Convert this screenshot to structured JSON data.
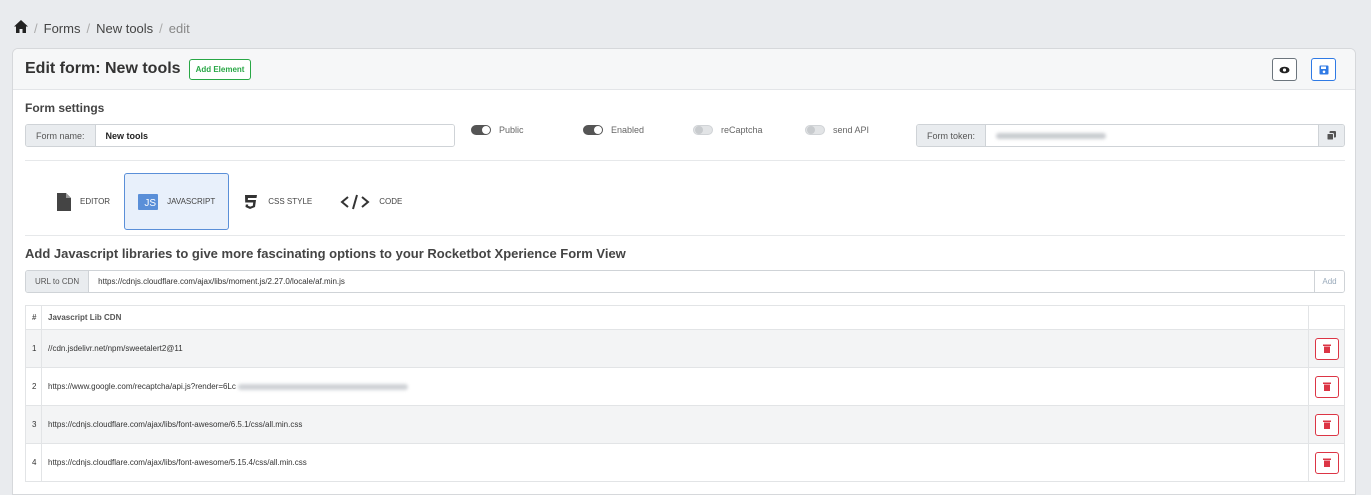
{
  "breadcrumb": {
    "items": [
      "Forms",
      "New tools",
      "edit"
    ],
    "separator": "/"
  },
  "header": {
    "title": "Edit form: New tools",
    "add_element_label": "Add Element"
  },
  "form_settings": {
    "title": "Form settings",
    "name_label": "Form name:",
    "name_value": "New tools",
    "toggles": [
      {
        "label": "Public",
        "on": true
      },
      {
        "label": "Enabled",
        "on": true
      },
      {
        "label": "reCaptcha",
        "on": false
      },
      {
        "label": "send API",
        "on": false
      }
    ],
    "token_label": "Form token:"
  },
  "tabs": [
    {
      "label": "EDITOR",
      "icon": "file-icon"
    },
    {
      "label": "JAVASCRIPT",
      "icon": "js-icon",
      "active": true
    },
    {
      "label": "CSS STYLE",
      "icon": "css3-icon"
    },
    {
      "label": "CODE",
      "icon": "code-icon"
    }
  ],
  "js_section": {
    "title": "Add Javascript libraries to give more fascinating options to your Rocketbot Xperience Form View",
    "cdn_label": "URL to CDN",
    "cdn_value": "https://cdnjs.cloudflare.com/ajax/libs/moment.js/2.27.0/locale/af.min.js",
    "add_label": "Add"
  },
  "table": {
    "headers": [
      "#",
      "Javascript Lib CDN"
    ],
    "rows": [
      {
        "num": "1",
        "url": "//cdn.jsdelivr.net/npm/sweetalert2@11"
      },
      {
        "num": "2",
        "url": "https://www.google.com/recaptcha/api.js?render=6Lc"
      },
      {
        "num": "3",
        "url": "https://cdnjs.cloudflare.com/ajax/libs/font-awesome/6.5.1/css/all.min.css"
      },
      {
        "num": "4",
        "url": "https://cdnjs.cloudflare.com/ajax/libs/font-awesome/5.15.4/css/all.min.css"
      }
    ]
  },
  "colors": {
    "accent": "#5a8fd8",
    "success": "#28a745",
    "danger": "#dc3545"
  }
}
